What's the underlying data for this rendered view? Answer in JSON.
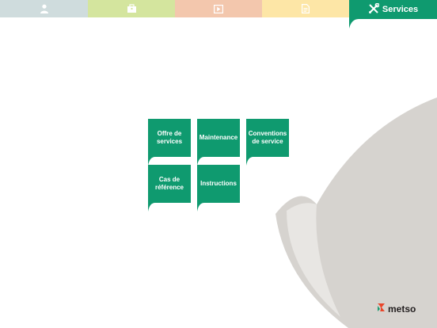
{
  "colors": {
    "accent": "#0f9a6f",
    "tab_people": "#cfdcdd",
    "tab_case": "#d4e59e",
    "tab_video": "#f3c7ad",
    "tab_doc": "#fde6a6",
    "decor_gray": "#d6d3cf",
    "logo_red": "#e9462b"
  },
  "tabs": [
    {
      "icon": "person-icon"
    },
    {
      "icon": "briefcase-icon"
    },
    {
      "icon": "play-icon"
    },
    {
      "icon": "document-icon"
    },
    {
      "icon": "wrench-screwdriver-icon",
      "label": "Services",
      "active": true
    }
  ],
  "tiles": [
    {
      "label": "Offre de\nservices"
    },
    {
      "label": "Maintenance"
    },
    {
      "label": "Conventions\nde service"
    },
    {
      "label": "Cas de\nréférence"
    },
    {
      "label": "Instructions"
    }
  ],
  "logo": {
    "text": "metso"
  }
}
